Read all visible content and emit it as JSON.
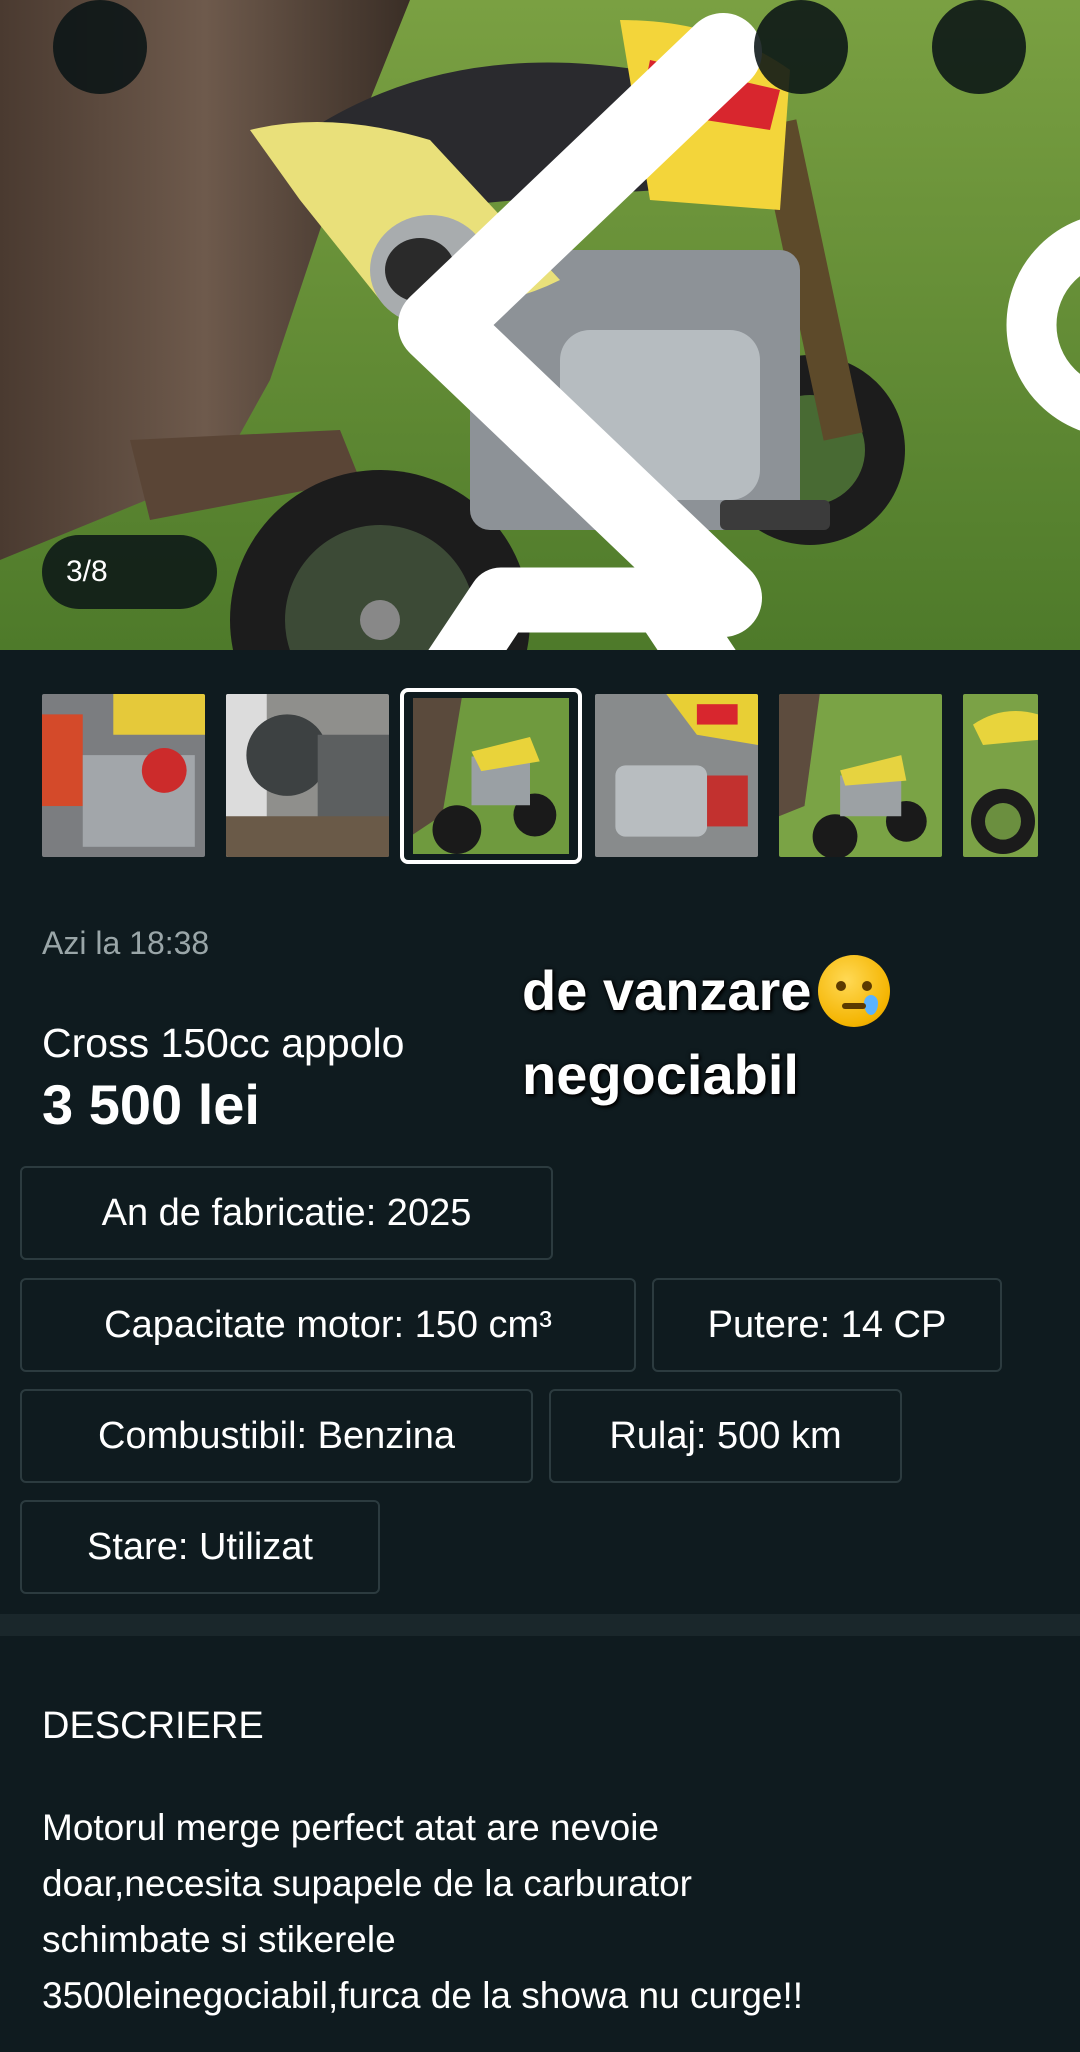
{
  "gallery": {
    "counter": "3/8",
    "thumbnail_count": 6,
    "selected_index": 2
  },
  "listing": {
    "date": "Azi la 18:38",
    "title": "Cross 150cc appolo",
    "price": "3 500 lei"
  },
  "overlay_caption": {
    "line1": "de vanzare",
    "line2": "negociabil"
  },
  "specs": {
    "year": "An de fabricatie: 2025",
    "engine": "Capacitate motor: 150 cm³",
    "power": "Putere: 14 CP",
    "fuel": "Combustibil: Benzina",
    "mileage": "Rulaj: 500 km",
    "condition": "Stare: Utilizat"
  },
  "description": {
    "heading": "DESCRIERE",
    "lines": [
      "Motorul merge perfect atat are nevoie",
      "doar,necesita supapele de la carburator",
      "schimbate si stikerele",
      "3500leinegociabil,furca de la showa nu curge!!"
    ]
  },
  "icons": {
    "back": "chevron-left-icon",
    "share": "share-icon",
    "more": "more-vertical-icon",
    "camera": "camera-icon"
  },
  "colors": {
    "background": "#0f1b1f",
    "chip_border": "#2c3b3f",
    "muted_text": "#9aa6a8"
  }
}
